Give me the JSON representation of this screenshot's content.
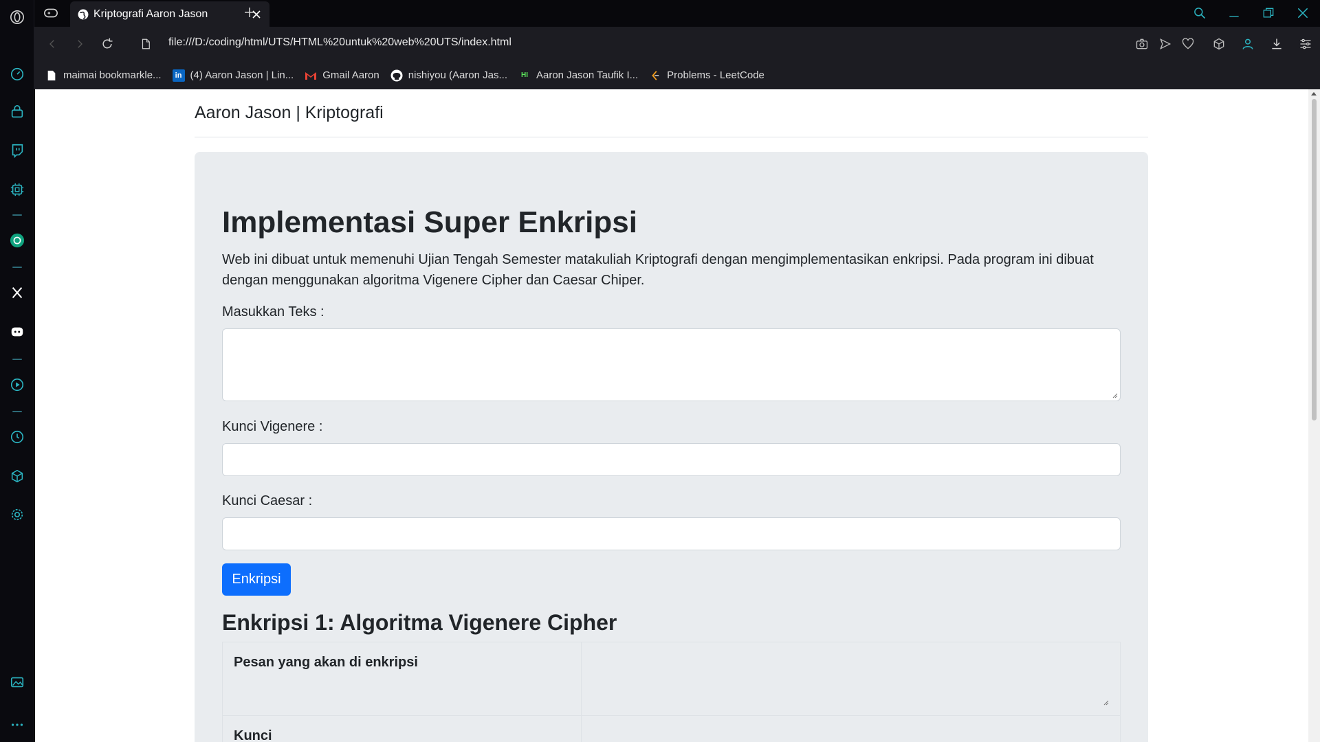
{
  "browser": {
    "tab_title": "Kriptografi Aaron Jason",
    "url": "file:///D:/coding/html/UTS/HTML%20untuk%20web%20UTS/index.html",
    "accent": "#2bb3c0"
  },
  "sidebar": {
    "icons": [
      "opera-logo-icon",
      "speed-dial-icon",
      "shopping-icon",
      "twitch-icon",
      "ai-icon",
      "chatgpt-icon",
      "x-icon",
      "discord-icon",
      "player-icon",
      "history-icon",
      "extensions-icon",
      "settings-icon",
      "gallery-icon",
      "more-icon"
    ]
  },
  "bookmarks": [
    {
      "label": "maimai bookmarkle...",
      "icon": "page-icon"
    },
    {
      "label": "(4) Aaron Jason | Lin...",
      "icon": "linkedin-icon"
    },
    {
      "label": "Gmail Aaron",
      "icon": "gmail-icon"
    },
    {
      "label": "nishiyou (Aaron Jas...",
      "icon": "github-icon"
    },
    {
      "label": "Aaron Jason Taufik I...",
      "icon": "hr-icon"
    },
    {
      "label": "Problems - LeetCode",
      "icon": "leetcode-icon"
    }
  ],
  "page": {
    "brand": "Aaron Jason | Kriptografi",
    "heading": "Implementasi Super Enkripsi",
    "lead": "Web ini dibuat untuk memenuhi Ujian Tengah Semester matakuliah Kriptografi dengan mengimplementasikan enkripsi. Pada program ini dibuat dengan menggunakan algoritma Vigenere Cipher dan Caesar Chiper.",
    "text_label": "Masukkan Teks :",
    "vigenere_label": "Kunci Vigenere :",
    "caesar_label": "Kunci Caesar :",
    "encrypt_button": "Enkripsi",
    "section1_title": "Enkripsi 1: Algoritma Vigenere Cipher",
    "table_rows": [
      "Pesan yang akan di enkripsi",
      "Kunci"
    ],
    "primary_color": "#0d6efd"
  }
}
